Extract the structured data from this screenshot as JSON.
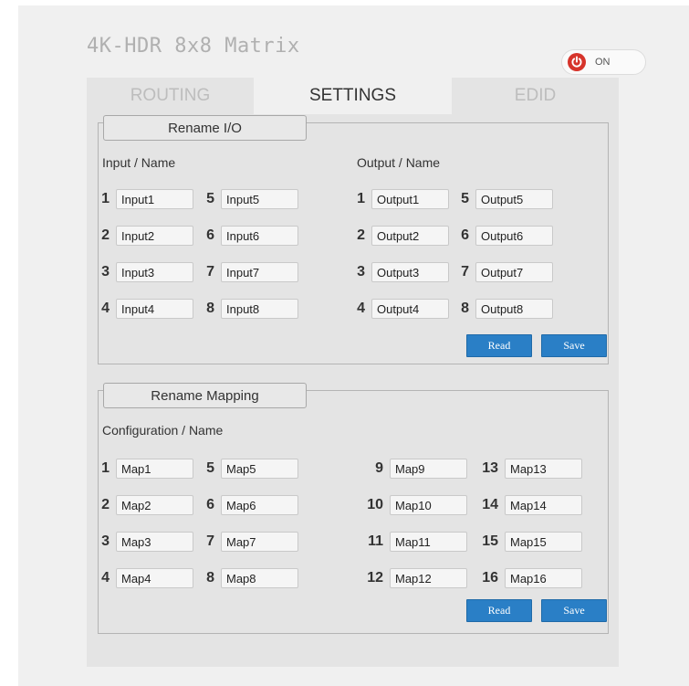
{
  "app": {
    "title": "4K-HDR 8x8 Matrix",
    "power": {
      "label": "ON",
      "state": "on"
    }
  },
  "tabs": [
    {
      "label": "ROUTING",
      "active": false
    },
    {
      "label": "SETTINGS",
      "active": true
    },
    {
      "label": "EDID",
      "active": false
    }
  ],
  "rename_io": {
    "title": "Rename I/O",
    "input_heading": "Input / Name",
    "output_heading": "Output / Name",
    "inputs": [
      {
        "num": "1",
        "value": "Input1"
      },
      {
        "num": "2",
        "value": "Input2"
      },
      {
        "num": "3",
        "value": "Input3"
      },
      {
        "num": "4",
        "value": "Input4"
      },
      {
        "num": "5",
        "value": "Input5"
      },
      {
        "num": "6",
        "value": "Input6"
      },
      {
        "num": "7",
        "value": "Input7"
      },
      {
        "num": "8",
        "value": "Input8"
      }
    ],
    "outputs": [
      {
        "num": "1",
        "value": "Output1"
      },
      {
        "num": "2",
        "value": "Output2"
      },
      {
        "num": "3",
        "value": "Output3"
      },
      {
        "num": "4",
        "value": "Output4"
      },
      {
        "num": "5",
        "value": "Output5"
      },
      {
        "num": "6",
        "value": "Output6"
      },
      {
        "num": "7",
        "value": "Output7"
      },
      {
        "num": "8",
        "value": "Output8"
      }
    ],
    "read_label": "Read",
    "save_label": "Save"
  },
  "rename_mapping": {
    "title": "Rename Mapping",
    "heading": "Configuration / Name",
    "maps": [
      {
        "num": "1",
        "value": "Map1"
      },
      {
        "num": "2",
        "value": "Map2"
      },
      {
        "num": "3",
        "value": "Map3"
      },
      {
        "num": "4",
        "value": "Map4"
      },
      {
        "num": "5",
        "value": "Map5"
      },
      {
        "num": "6",
        "value": "Map6"
      },
      {
        "num": "7",
        "value": "Map7"
      },
      {
        "num": "8",
        "value": "Map8"
      },
      {
        "num": "9",
        "value": "Map9"
      },
      {
        "num": "10",
        "value": "Map10"
      },
      {
        "num": "11",
        "value": "Map11"
      },
      {
        "num": "12",
        "value": "Map12"
      },
      {
        "num": "13",
        "value": "Map13"
      },
      {
        "num": "14",
        "value": "Map14"
      },
      {
        "num": "15",
        "value": "Map15"
      },
      {
        "num": "16",
        "value": "Map16"
      }
    ],
    "read_label": "Read",
    "save_label": "Save"
  },
  "colors": {
    "accent": "#2a7fc6",
    "power": "#d6332a",
    "panel": "#e4e4e4",
    "page": "#f0f0f0"
  }
}
